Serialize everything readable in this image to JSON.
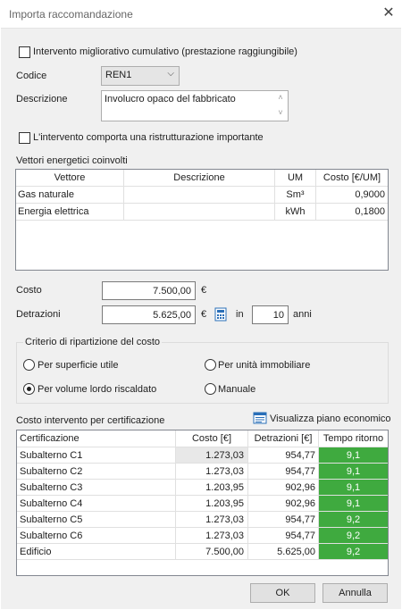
{
  "window": {
    "title": "Importa raccomandazione"
  },
  "intervento_migliorativo": {
    "label": "Intervento migliorativo cumulativo (prestazione raggiungibile)",
    "checked": false
  },
  "codice": {
    "label": "Codice",
    "value": "REN1"
  },
  "descrizione": {
    "label": "Descrizione",
    "value": "Involucro opaco del fabbricato"
  },
  "ristrutturazione": {
    "label": "L'intervento comporta una ristrutturazione importante",
    "checked": false
  },
  "vettori": {
    "label": "Vettori energetici coinvolti",
    "headers": [
      "Vettore",
      "Descrizione",
      "UM",
      "Costo [€/UM]"
    ],
    "rows": [
      [
        "Gas naturale",
        "",
        "Sm³",
        "0,9000"
      ],
      [
        "Energia elettrica",
        "",
        "kWh",
        "0,1800"
      ]
    ]
  },
  "costo": {
    "label": "Costo",
    "value": "7.500,00",
    "unit": "€"
  },
  "detrazioni": {
    "label": "Detrazioni",
    "value": "5.625,00",
    "unit": "€",
    "in_label": "in",
    "years": "10",
    "years_label": "anni",
    "calc_icon": "calculator-icon"
  },
  "criterio": {
    "label": "Criterio di ripartizione del costo",
    "options": [
      "Per superficie utile",
      "Per unità immobiliare",
      "Per volume lordo riscaldato",
      "Manuale"
    ],
    "selected": "Per volume lordo riscaldato"
  },
  "certificazione": {
    "label": "Costo intervento per certificazione",
    "piano_label": "Visualizza piano economico",
    "headers": [
      "Certificazione",
      "Costo [€]",
      "Detrazioni [€]",
      "Tempo ritorno"
    ],
    "rows": [
      [
        "Subalterno C1",
        "1.273,03",
        "954,77",
        "9,1"
      ],
      [
        "Subalterno C2",
        "1.273,03",
        "954,77",
        "9,1"
      ],
      [
        "Subalterno C3",
        "1.203,95",
        "902,96",
        "9,1"
      ],
      [
        "Subalterno C4",
        "1.203,95",
        "902,96",
        "9,1"
      ],
      [
        "Subalterno C5",
        "1.273,03",
        "954,77",
        "9,2"
      ],
      [
        "Subalterno C6",
        "1.273,03",
        "954,77",
        "9,2"
      ],
      [
        "Edificio",
        "7.500,00",
        "5.625,00",
        "9,2"
      ]
    ],
    "highlight_color": "#3faa3f"
  },
  "buttons": {
    "ok": "OK",
    "cancel": "Annulla"
  }
}
